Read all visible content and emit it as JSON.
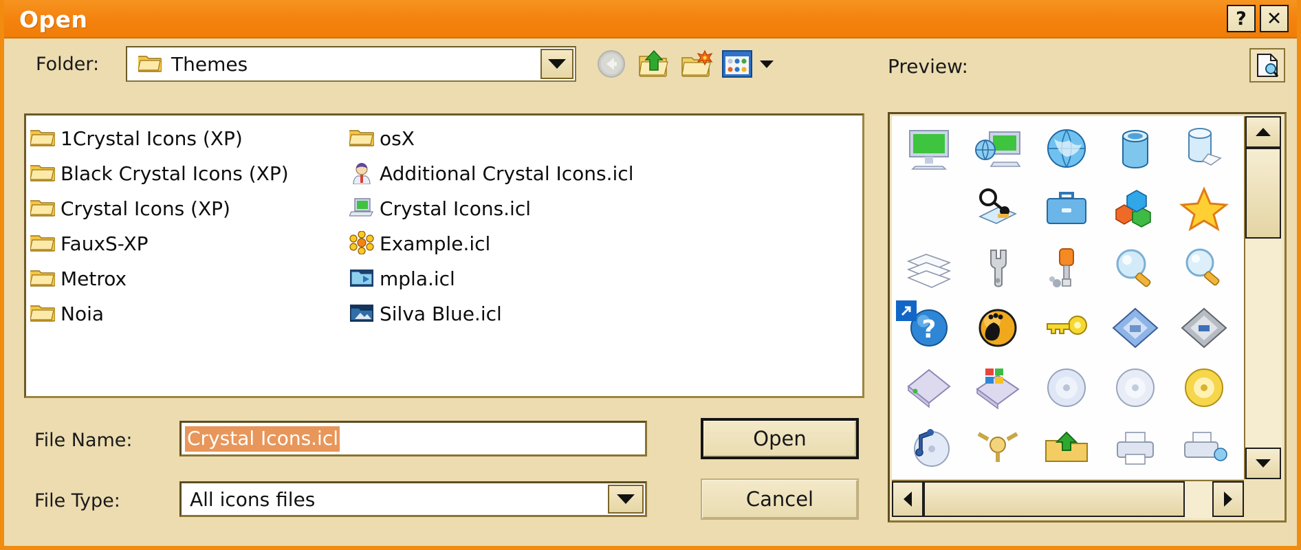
{
  "window": {
    "title": "Open",
    "help_button": "?",
    "close_button": "✕",
    "accent_color": "#f58410",
    "face_color": "#ecdcb0"
  },
  "toolbar": {
    "folder_label": "Folder:",
    "current_folder": "Themes",
    "buttons": [
      {
        "name": "back",
        "icon": "back-arrow-icon",
        "enabled": false
      },
      {
        "name": "up-one-level",
        "icon": "folder-up-icon",
        "enabled": true
      },
      {
        "name": "new-folder",
        "icon": "new-folder-icon",
        "enabled": true
      },
      {
        "name": "views",
        "icon": "views-grid-icon",
        "enabled": true
      }
    ]
  },
  "preview": {
    "label": "Preview:",
    "toggle_icon": "document-preview-icon",
    "icons": [
      "monitor-green-screen-icon",
      "network-computer-icon",
      "globe-icon",
      "database-cylinder-icon",
      "database-copy-icon",
      "magnifier-inspect-icon",
      "briefcase-icon",
      "colored-blocks-icon",
      "star-icon",
      "documents-stack-icon",
      "wrench-icon",
      "screwdriver-icon",
      "magnifier-blue-icon",
      "magnifier-plain-icon",
      "help-question-icon",
      "gnome-foot-icon",
      "key-icon",
      "floppy-blue-icon",
      "floppy-grey-icon",
      "box-violet-icon",
      "windows-box-icon",
      "cd-disc-icon",
      "cd-disc-plain-icon",
      "cd-disc-gold-icon",
      "cd-music-icon",
      "network-plug-icon",
      "folder-green-arrow-icon",
      "printer-icon",
      "printer-network-icon",
      "device-green-icon"
    ],
    "shortcut_badge": "shortcut-arrow-icon",
    "scroll": {
      "vertical": {
        "up": "▲",
        "down": "▼",
        "thumb_position": "top"
      },
      "horizontal": {
        "left": "◀",
        "right": "▶",
        "thumb_position": "left"
      }
    }
  },
  "file_list": {
    "column_left": [
      {
        "name": "1Crystal Icons (XP)",
        "type": "folder",
        "icon": "folder-yellow-icon"
      },
      {
        "name": "Black Crystal Icons (XP)",
        "type": "folder",
        "icon": "folder-yellow-icon"
      },
      {
        "name": "Crystal Icons (XP)",
        "type": "folder",
        "icon": "folder-yellow-icon"
      },
      {
        "name": "FauxS-XP",
        "type": "folder",
        "icon": "folder-yellow-icon"
      },
      {
        "name": "Metrox",
        "type": "folder",
        "icon": "folder-yellow-icon"
      },
      {
        "name": "Noia",
        "type": "folder",
        "icon": "folder-yellow-icon"
      }
    ],
    "column_right": [
      {
        "name": "osX",
        "type": "folder",
        "icon": "folder-yellow-icon"
      },
      {
        "name": "Additional Crystal Icons.icl",
        "type": "file",
        "icon": "person-avatar-icon"
      },
      {
        "name": "Crystal Icons.icl",
        "type": "file",
        "icon": "laptop-green-icon"
      },
      {
        "name": "Example.icl",
        "type": "file",
        "icon": "orange-flower-icon"
      },
      {
        "name": "mpla.icl",
        "type": "file",
        "icon": "folder-blue-icon"
      },
      {
        "name": "Silva Blue.icl",
        "type": "file",
        "icon": "folder-darkblue-icon"
      }
    ]
  },
  "fields": {
    "file_name_label": "File Name:",
    "file_name_value": "Crystal Icons.icl",
    "file_name_selected": true,
    "file_type_label": "File Type:",
    "file_type_value": "All icons files"
  },
  "actions": {
    "open_label": "Open",
    "cancel_label": "Cancel"
  }
}
